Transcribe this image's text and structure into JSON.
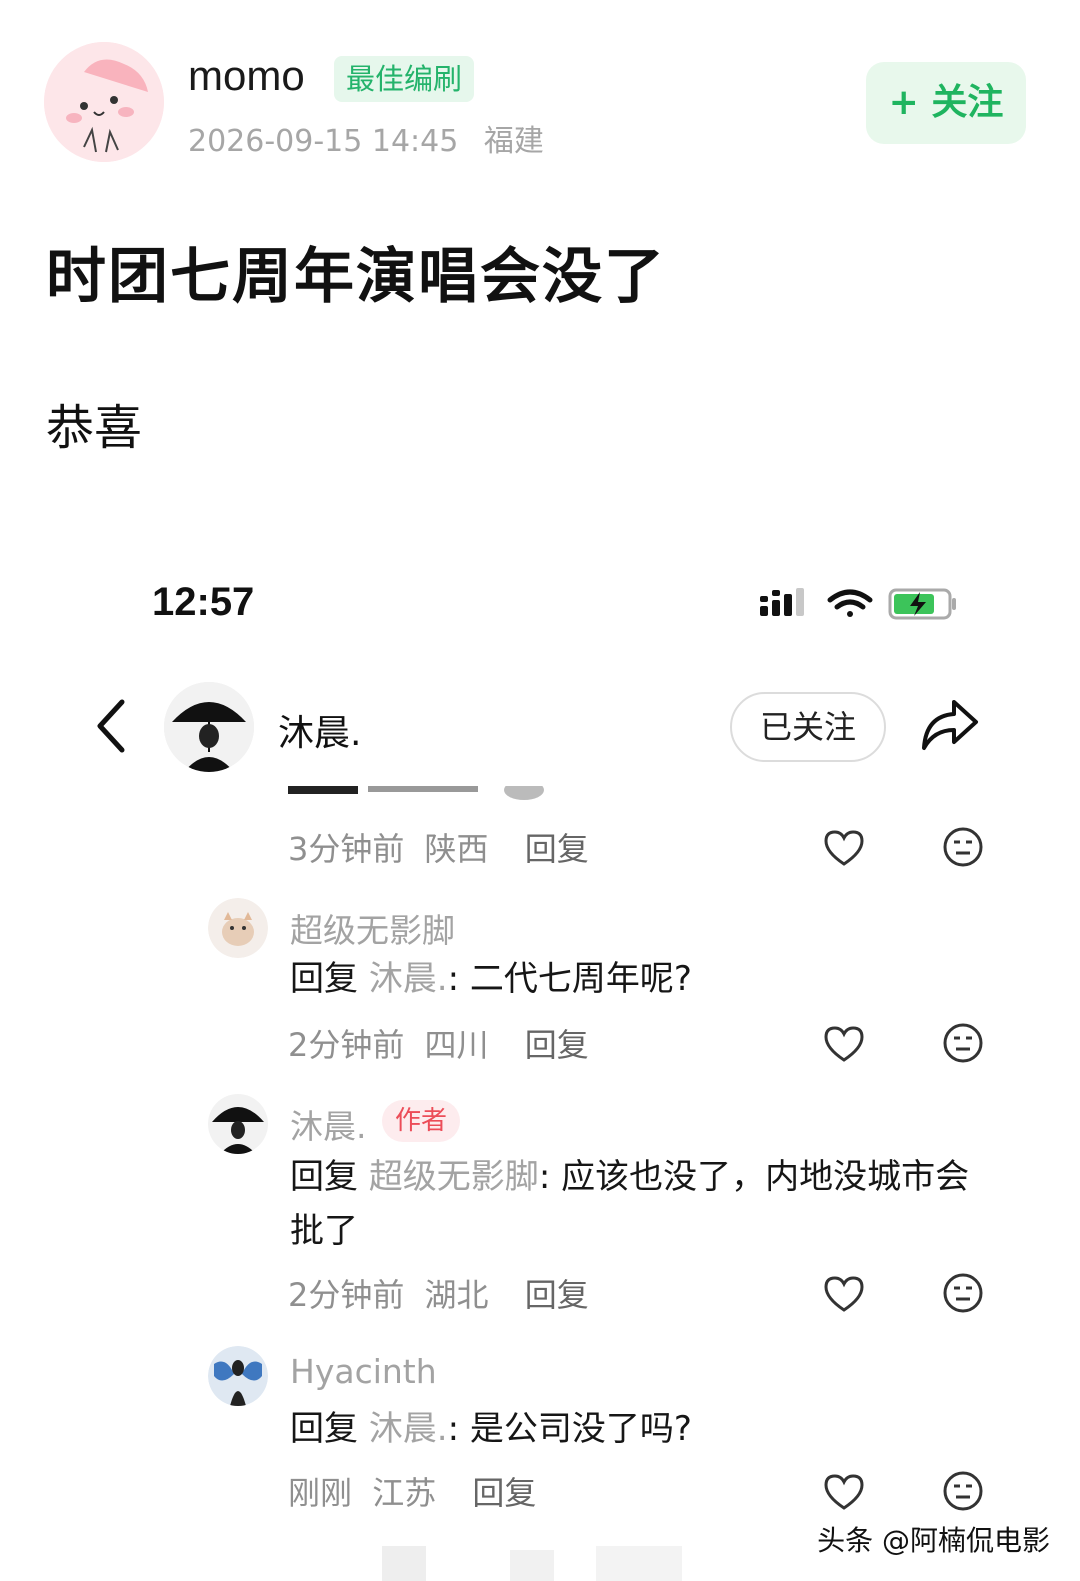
{
  "post": {
    "author": "momo",
    "badge": "最佳编刷",
    "date": "2026-09-15 14:45",
    "location": "福建",
    "follow_label": "+ 关注",
    "title": "时团七周年演唱会没了",
    "body": "恭喜"
  },
  "screenshot": {
    "status_time": "12:57",
    "nav": {
      "name": "沐晨.",
      "followed_label": "已关注"
    },
    "first_meta": {
      "time": "3分钟前",
      "location": "陕西",
      "reply": "回复"
    },
    "comments": [
      {
        "name": "超级无影脚",
        "reply_prefix": "回复",
        "mention": "沐晨.",
        "text": ": 二代七周年呢?",
        "time": "2分钟前",
        "location": "四川",
        "reply": "回复"
      },
      {
        "name": "沐晨.",
        "tag": "作者",
        "reply_prefix": "回复",
        "mention": "超级无影脚",
        "text": ": 应该也没了，内地没城市会批了",
        "time": "2分钟前",
        "location": "湖北",
        "reply": "回复"
      },
      {
        "name": "Hyacinth",
        "reply_prefix": "回复",
        "mention": "沐晨.",
        "text": ": 是公司没了吗?",
        "time": "刚刚",
        "location": "江苏",
        "reply": "回复"
      }
    ]
  },
  "watermark": "头条 @阿楠侃电影",
  "colors": {
    "accent_green": "#1fb45f",
    "badge_green": "#24b36b",
    "author_tag_red": "#ec4d59",
    "muted_gray": "#a3a3a3"
  },
  "icons": [
    "back-icon",
    "share-icon",
    "heart-icon",
    "face-icon",
    "signal-icon",
    "wifi-icon",
    "battery-icon"
  ]
}
